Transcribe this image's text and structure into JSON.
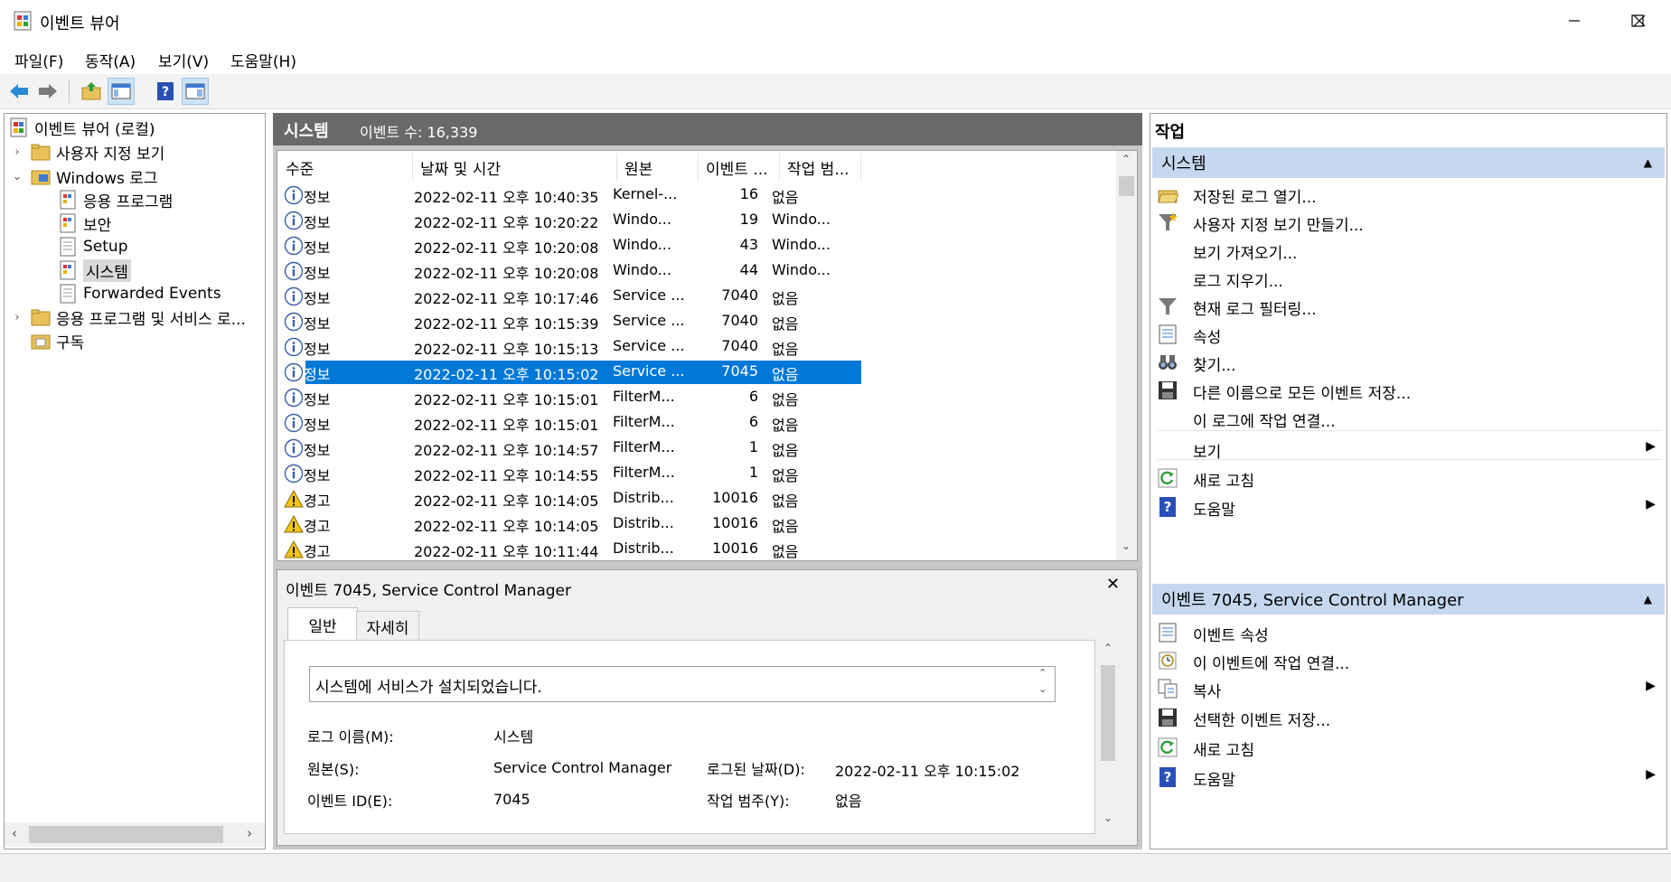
{
  "window": {
    "title": "이벤트 뷰어",
    "controls": [
      "minimize",
      "maximize",
      "close"
    ]
  },
  "menu": [
    "파일(F)",
    "동작(A)",
    "보기(V)",
    "도움말(H)"
  ],
  "toolbar": {
    "buttons": [
      "back-arrow-icon",
      "forward-arrow-icon",
      "up-folder-icon",
      "show-hide-tree-icon",
      "help-icon",
      "show-hide-action-icon"
    ]
  },
  "tree": {
    "root": "이벤트 뷰어 (로컬)",
    "custom_views": "사용자 지정 보기",
    "windows_logs": "Windows 로그",
    "application": "응용 프로그램",
    "security": "보안",
    "setup": "Setup",
    "system": "시스템",
    "forwarded": "Forwarded Events",
    "app_services": "응용 프로그램 및 서비스 로...",
    "subscriptions": "구독"
  },
  "list": {
    "title": "시스템",
    "count_label": "이벤트 수: 16,339",
    "columns": [
      "수준",
      "날짜 및 시간",
      "원본",
      "이벤트 ...",
      "작업 범..."
    ],
    "rows": [
      {
        "level": "정보",
        "type": "info",
        "datetime": "2022-02-11 오후 10:40:35",
        "source": "Kernel-...",
        "id": "16",
        "category": "없음"
      },
      {
        "level": "정보",
        "type": "info",
        "datetime": "2022-02-11 오후 10:20:22",
        "source": "Windo...",
        "id": "19",
        "category": "Windo..."
      },
      {
        "level": "정보",
        "type": "info",
        "datetime": "2022-02-11 오후 10:20:08",
        "source": "Windo...",
        "id": "43",
        "category": "Windo..."
      },
      {
        "level": "정보",
        "type": "info",
        "datetime": "2022-02-11 오후 10:20:08",
        "source": "Windo...",
        "id": "44",
        "category": "Windo..."
      },
      {
        "level": "정보",
        "type": "info",
        "datetime": "2022-02-11 오후 10:17:46",
        "source": "Service ...",
        "id": "7040",
        "category": "없음"
      },
      {
        "level": "정보",
        "type": "info",
        "datetime": "2022-02-11 오후 10:15:39",
        "source": "Service ...",
        "id": "7040",
        "category": "없음"
      },
      {
        "level": "정보",
        "type": "info",
        "datetime": "2022-02-11 오후 10:15:13",
        "source": "Service ...",
        "id": "7040",
        "category": "없음"
      },
      {
        "level": "정보",
        "type": "info",
        "datetime": "2022-02-11 오후 10:15:02",
        "source": "Service ...",
        "id": "7045",
        "category": "없음",
        "selected": true
      },
      {
        "level": "정보",
        "type": "info",
        "datetime": "2022-02-11 오후 10:15:01",
        "source": "FilterM...",
        "id": "6",
        "category": "없음"
      },
      {
        "level": "정보",
        "type": "info",
        "datetime": "2022-02-11 오후 10:15:01",
        "source": "FilterM...",
        "id": "6",
        "category": "없음"
      },
      {
        "level": "정보",
        "type": "info",
        "datetime": "2022-02-11 오후 10:14:57",
        "source": "FilterM...",
        "id": "1",
        "category": "없음"
      },
      {
        "level": "정보",
        "type": "info",
        "datetime": "2022-02-11 오후 10:14:55",
        "source": "FilterM...",
        "id": "1",
        "category": "없음"
      },
      {
        "level": "경고",
        "type": "warning",
        "datetime": "2022-02-11 오후 10:14:05",
        "source": "Distrib...",
        "id": "10016",
        "category": "없음"
      },
      {
        "level": "경고",
        "type": "warning",
        "datetime": "2022-02-11 오후 10:14:05",
        "source": "Distrib...",
        "id": "10016",
        "category": "없음"
      },
      {
        "level": "경고",
        "type": "warning",
        "datetime": "2022-02-11 오후 10:11:44",
        "source": "Distrib...",
        "id": "10016",
        "category": "없음"
      }
    ]
  },
  "detail": {
    "title": "이벤트 7045, Service Control Manager",
    "tabs": [
      "일반",
      "자세히"
    ],
    "description": "시스템에 서비스가 설치되었습니다.",
    "fields": {
      "log_name_label": "로그 이름(M):",
      "log_name": "시스템",
      "source_label": "원본(S):",
      "source": "Service Control Manager",
      "logged_label": "로그된 날짜(D):",
      "logged": "2022-02-11 오후 10:15:02",
      "event_id_label": "이벤트 ID(E):",
      "event_id": "7045",
      "task_label": "작업 범주(Y):",
      "task": "없음"
    }
  },
  "actions": {
    "title": "작업",
    "section1": "시스템",
    "items1": [
      {
        "label": "저장된 로그 열기...",
        "icon": "open-folder-icon"
      },
      {
        "label": "사용자 지정 보기 만들기...",
        "icon": "filter-star-icon"
      },
      {
        "label": "보기 가져오기...",
        "icon": ""
      },
      {
        "label": "로그 지우기...",
        "icon": ""
      },
      {
        "label": "현재 로그 필터링...",
        "icon": "filter-icon"
      },
      {
        "label": "속성",
        "icon": "properties-icon"
      },
      {
        "label": "찾기...",
        "icon": "binoculars-icon"
      },
      {
        "label": "다른 이름으로 모든 이벤트 저장...",
        "icon": "save-icon"
      },
      {
        "label": "이 로그에 작업 연결...",
        "icon": ""
      },
      {
        "label": "보기",
        "icon": "",
        "submenu": true
      },
      {
        "label": "새로 고침",
        "icon": "refresh-icon"
      },
      {
        "label": "도움말",
        "icon": "help-icon",
        "submenu": true
      }
    ],
    "section2": "이벤트 7045, Service Control Manager",
    "items2": [
      {
        "label": "이벤트 속성",
        "icon": "properties-icon"
      },
      {
        "label": "이 이벤트에 작업 연결...",
        "icon": "task-clock-icon"
      },
      {
        "label": "복사",
        "icon": "copy-icon",
        "submenu": true
      },
      {
        "label": "선택한 이벤트 저장...",
        "icon": "save-icon"
      },
      {
        "label": "새로 고침",
        "icon": "refresh-icon"
      },
      {
        "label": "도움말",
        "icon": "help-icon",
        "submenu": true
      }
    ]
  },
  "colors": {
    "selection": "#0078d7",
    "section_header": "#c5d8ef",
    "list_header": "#696969"
  }
}
